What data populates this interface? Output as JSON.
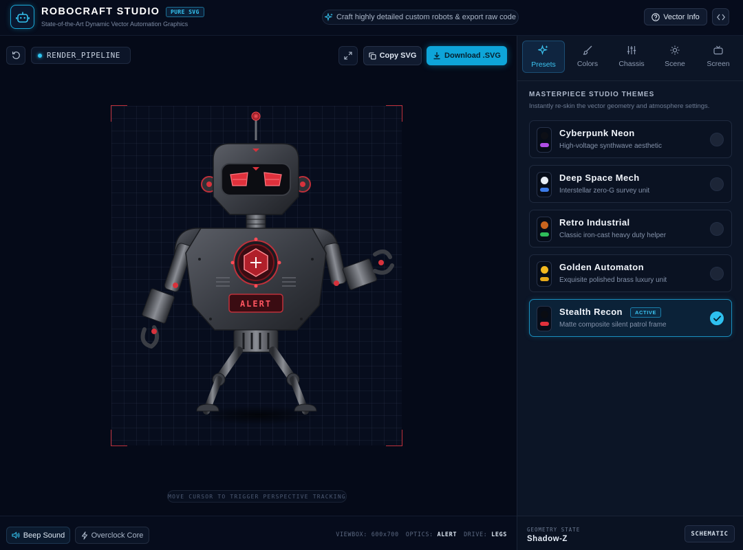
{
  "header": {
    "app_title": "ROBOCRAFT STUDIO",
    "badge": "PURE SVG",
    "subtitle": "State-of-the-Art Dynamic Vector Automation Graphics",
    "tagline": "Craft highly detailed custom robots & export raw code",
    "vector_info_label": "Vector Info"
  },
  "canvas": {
    "pipeline_label": "RENDER_PIPELINE",
    "copy_label": "Copy SVG",
    "download_label": "Download .SVG",
    "chest_display": "ALERT",
    "hint": "MOVE CURSOR TO TRIGGER PERSPECTIVE TRACKING",
    "accent_color": "#e0313c"
  },
  "bottom": {
    "beep_label": "Beep Sound",
    "overclock_label": "Overclock Core",
    "viewbox_key": "VIEWBOX:",
    "viewbox_value": "600x700",
    "optics_key": "OPTICS:",
    "optics_value": "ALERT",
    "drive_key": "DRIVE:",
    "drive_value": "LEGS"
  },
  "panel": {
    "tabs": [
      {
        "label": "Presets",
        "icon": "sparkles-icon",
        "active": true
      },
      {
        "label": "Colors",
        "icon": "brush-icon",
        "active": false
      },
      {
        "label": "Chassis",
        "icon": "sliders-icon",
        "active": false
      },
      {
        "label": "Scene",
        "icon": "sun-icon",
        "active": false
      },
      {
        "label": "Screen",
        "icon": "tv-icon",
        "active": false
      }
    ],
    "section_title": "MASTERPIECE STUDIO THEMES",
    "section_sub": "Instantly re-skin the vector geometry and atmosphere settings.",
    "active_badge": "ACTIVE",
    "presets": [
      {
        "name": "Cyberpunk Neon",
        "desc": "High-voltage synthwave aesthetic",
        "dot": "#0d0f16",
        "bar": "#b04ee8",
        "active": false
      },
      {
        "name": "Deep Space Mech",
        "desc": "Interstellar zero-G survey unit",
        "dot": "#e8edf5",
        "bar": "#3c7be8",
        "active": false
      },
      {
        "name": "Retro Industrial",
        "desc": "Classic iron-cast heavy duty helper",
        "dot": "#c8641e",
        "bar": "#2fbd5a",
        "active": false
      },
      {
        "name": "Golden Automaton",
        "desc": "Exquisite polished brass luxury unit",
        "dot": "#f2b81f",
        "bar": "#e6a91a",
        "active": false
      },
      {
        "name": "Stealth Recon",
        "desc": "Matte composite silent patrol frame",
        "dot": "#0a0c12",
        "bar": "#e0313c",
        "active": true
      }
    ],
    "geometry_label": "GEOMETRY STATE",
    "geometry_value": "Shadow-Z",
    "schematic_label": "SCHEMATIC"
  }
}
